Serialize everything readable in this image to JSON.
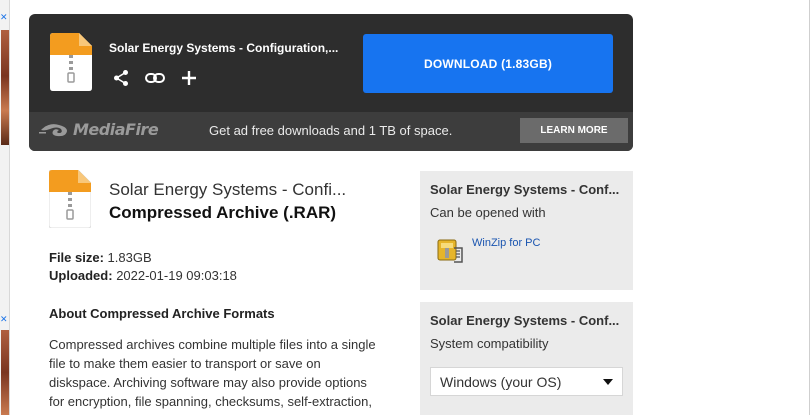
{
  "download_panel": {
    "file_title": "Solar Energy Systems - Configuration,...",
    "download_label": "DOWNLOAD (1.83GB)",
    "actions": [
      "share-icon",
      "link-icon",
      "plus-icon"
    ],
    "brand": "MediaFire",
    "promo_text": "Get ad free downloads and 1 TB of space.",
    "learn_more_label": "LEARN MORE"
  },
  "file_info": {
    "name": "Solar Energy Systems - Confi...",
    "type": "Compressed Archive (.RAR)",
    "size_label": "File size:",
    "size_value": "1.83GB",
    "uploaded_label": "Uploaded:",
    "uploaded_value": "2022-01-19 09:03:18",
    "about_heading": "About Compressed Archive Formats",
    "about_text": "Compressed archives combine multiple files into a single file to make them easier to transport or save on diskspace. Archiving software may also provide options for encryption, file spanning, checksums, self-extraction, and self-installation. Zip is the most-widely used format"
  },
  "open_with": {
    "title": "Solar Energy Systems - Conf...",
    "subtitle": "Can be opened with",
    "app_label": "WinZip for PC"
  },
  "compatibility": {
    "title": "Solar Energy Systems - Conf...",
    "subtitle": "System compatibility",
    "selected_os": "Windows (your OS)"
  },
  "colors": {
    "panel_bg": "#2d2d2d",
    "download_blue": "#1774f0",
    "side_bg": "#ebebeb",
    "link_blue": "#1a55b0"
  }
}
